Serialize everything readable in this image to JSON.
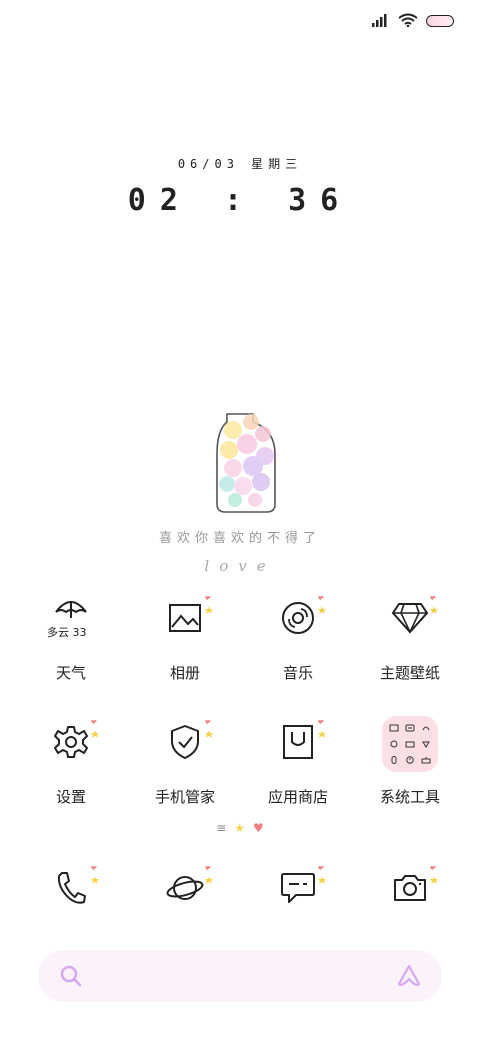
{
  "status_bar": {
    "signal": "signal-icon",
    "wifi": "wifi-icon",
    "battery": "battery-icon",
    "battery_color": "#fcd4e0"
  },
  "lock": {
    "date": "06/03 星期三",
    "time": "02 : 36"
  },
  "widget": {
    "slogan": "喜欢你喜欢的不得了",
    "love": "love",
    "image": "flower-jar-illustration"
  },
  "weather": {
    "icon": "umbrella-icon",
    "text": "多云 33"
  },
  "apps_row1": [
    {
      "label": "天气",
      "icon": "umbrella-icon"
    },
    {
      "label": "相册",
      "icon": "picture-icon"
    },
    {
      "label": "音乐",
      "icon": "disc-icon"
    },
    {
      "label": "主题壁纸",
      "icon": "diamond-icon"
    }
  ],
  "apps_row2": [
    {
      "label": "设置",
      "icon": "gear-icon"
    },
    {
      "label": "手机管家",
      "icon": "shield-check-icon"
    },
    {
      "label": "应用商店",
      "icon": "shopping-bag-icon"
    },
    {
      "label": "系统工具",
      "icon": "tools-folder-icon"
    }
  ],
  "page_indicator": {
    "icons": [
      "menu-icon",
      "star-icon",
      "heart-icon"
    ]
  },
  "dock": [
    {
      "icon": "phone-icon"
    },
    {
      "icon": "planet-icon"
    },
    {
      "icon": "message-icon"
    },
    {
      "icon": "camera-icon"
    }
  ],
  "search_bar": {
    "left_icon": "search-icon",
    "right_icon": "assistant-icon",
    "accent": "#d6a8f0"
  },
  "colors": {
    "heart": "#f08080",
    "star": "#f4d44d",
    "tile": "#fde0e6"
  }
}
